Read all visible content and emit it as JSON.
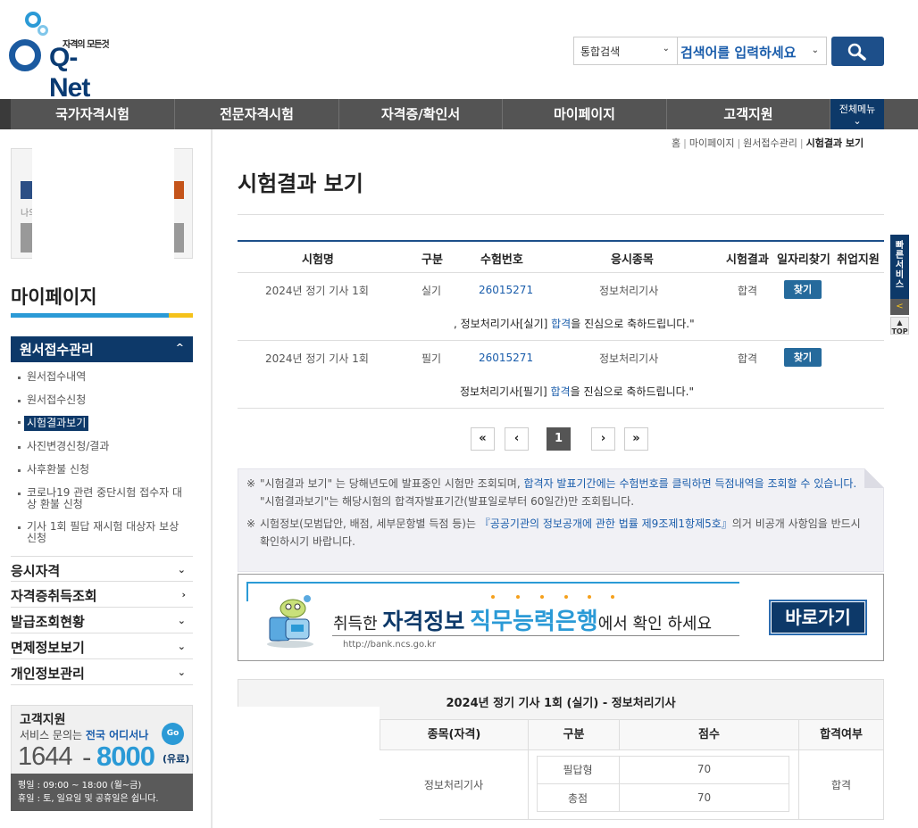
{
  "header": {
    "logo_tagline": "자격의 모든것",
    "logo_text": "Q-Net",
    "search_scope": "통합검색",
    "search_placeholder": "검색어를 입력하세요"
  },
  "gnb": {
    "items": [
      "국가자격시험",
      "전문자격시험",
      "자격증/확인서",
      "마이페이지",
      "고객지원"
    ],
    "all_menu": "전체메뉴"
  },
  "sidebar": {
    "login_partial": "나의",
    "title": "마이페이지",
    "section": "원서접수관리",
    "sub_items": [
      "원서접수내역",
      "원서접수신청",
      "시험결과보기",
      "사진변경신청/결과",
      "사후환불 신청",
      "코로나19 관련 중단시험 접수자 대상 환불 신청",
      "기사 1회 필답 재시험 대상자 보상 신청"
    ],
    "menus": [
      "응시자격",
      "자격증취득조회",
      "발급조회현황",
      "면제정보보기",
      "개인정보관리"
    ],
    "cs": {
      "title": "고객지원",
      "desc_prefix": "서비스 문의는 ",
      "desc_hl": "전국 어디서나",
      "go": "Go",
      "num1": "1644",
      "dash": "-",
      "num2": "8000",
      "paid": "(유료)",
      "hours": "평일 : 09:00 ~ 18:00 (월~금)",
      "holiday": "휴일 : 토, 일요일 및 공휴일은 쉽니다."
    }
  },
  "breadcrumb": {
    "home": "홈",
    "l1": "마이페이지",
    "l2": "원서접수관리",
    "current": "시험결과 보기"
  },
  "page_title": "시험결과 보기",
  "results": {
    "headers": [
      "시험명",
      "구분",
      "수험번호",
      "응시종목",
      "시험결과",
      "일자리찾기",
      "취업지원"
    ],
    "rows": [
      {
        "exam": "2024년 정기 기사 1회",
        "type": "실기",
        "number": "26015271",
        "subject": "정보처리기사",
        "result": "합격",
        "find": "찾기",
        "congrats_a": ", 정보처리기사[실기] ",
        "congrats_pass": "합격",
        "congrats_b": "을 진심으로 축하드립니다.\""
      },
      {
        "exam": "2024년 정기 기사 1회",
        "type": "필기",
        "number": "26015271",
        "subject": "정보처리기사",
        "result": "합격",
        "find": "찾기",
        "congrats_a": "정보처리기사[필기] ",
        "congrats_pass": "합격",
        "congrats_b": "을 진심으로 축하드립니다.\""
      }
    ]
  },
  "pagination": {
    "first": "«",
    "prev": "‹",
    "current": "1",
    "next": "›",
    "last": "»"
  },
  "notice": {
    "mark": "※",
    "n1_a": "\"시험결과 보기\" 는 당해년도에 발표중인 시험만 조회되며, ",
    "n1_hl": "합격자 발표기간에는 수험번호를 클릭하면 득점내역을 조회할 수 있습니다.",
    "n1_b": " \"시험결과보기\"는 해당시험의 합격자발표기간(발표일로부터 60일간)만 조회됩니다.",
    "n2_a": "시험정보(모범답안, 배점, 세부문항별 득점 등)는 ",
    "n2_hl": "『공공기관의 정보공개에 관한 법률 제9조제1항제5호』",
    "n2_b": "의거 비공개 사항임을 반드시 확인하시기 바랍니다."
  },
  "banner": {
    "pre": "취득한 ",
    "b1": "자격정보",
    "b2": "직무능력은행",
    "post": "에서 확인 하세요",
    "url": "http://bank.ncs.go.kr",
    "button": "바로가기"
  },
  "detail": {
    "title": "2024년 정기 기사 1회 (실기) - 정보처리기사",
    "headers": [
      "종목(자격)",
      "구분",
      "점수",
      "합격여부"
    ],
    "subject": "정보처리기사",
    "rows": [
      {
        "type": "필답형",
        "score": "70"
      },
      {
        "type": "총점",
        "score": "70"
      }
    ],
    "result": "합격"
  },
  "quick": {
    "label": "빠른서비스",
    "top": "TOP"
  },
  "colors": {
    "primary": "#0d3969",
    "accent": "#2b9ad6",
    "link": "#1a5dab",
    "nav": "#545454",
    "yellow": "#f5c21b"
  }
}
